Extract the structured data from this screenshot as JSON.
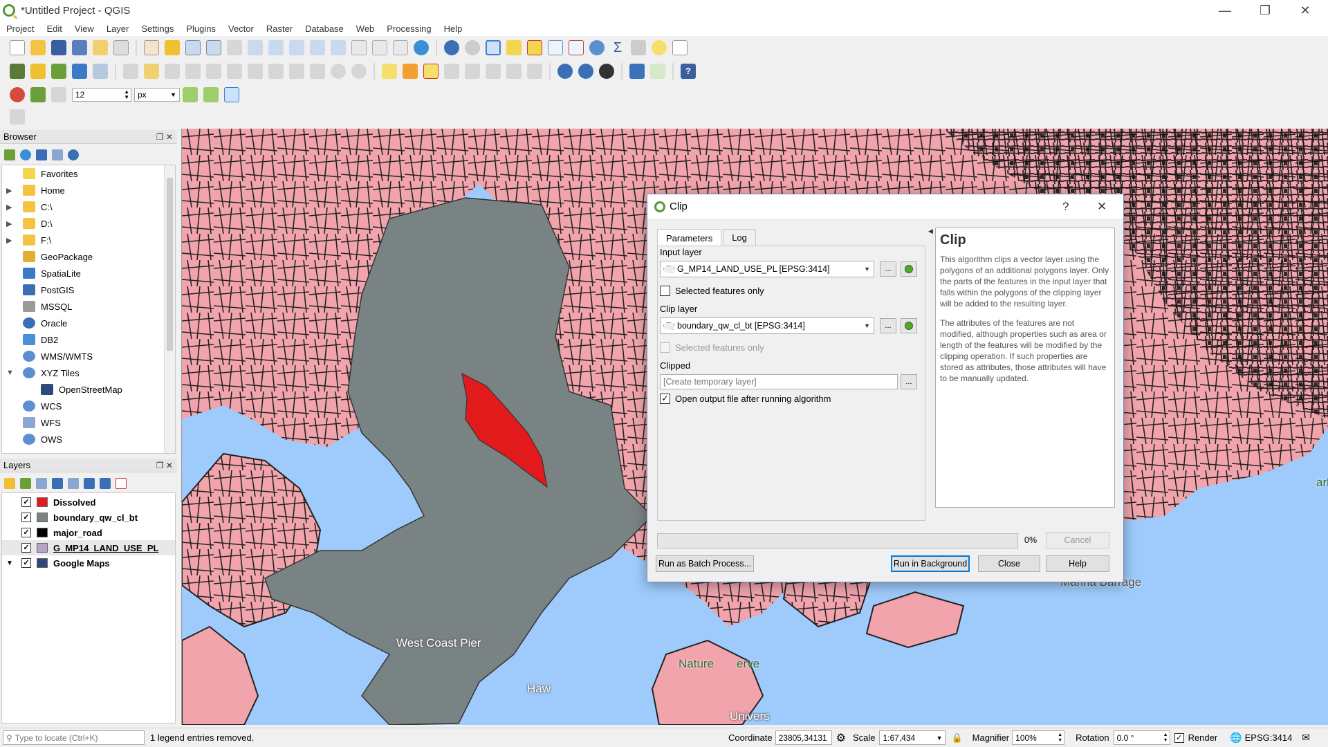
{
  "window": {
    "title": "*Untitled Project - QGIS"
  },
  "menu": [
    "Project",
    "Edit",
    "View",
    "Layer",
    "Settings",
    "Plugins",
    "Vector",
    "Raster",
    "Database",
    "Web",
    "Processing",
    "Help"
  ],
  "toolbar": {
    "snapping_tolerance": "12",
    "snapping_units": "px"
  },
  "browser": {
    "title": "Browser",
    "items": [
      {
        "label": "Favorites",
        "icon": "star-icon",
        "expandable": false
      },
      {
        "label": "Home",
        "icon": "folder-icon",
        "expandable": true
      },
      {
        "label": "C:\\",
        "icon": "folder-icon",
        "expandable": true
      },
      {
        "label": "D:\\",
        "icon": "folder-icon",
        "expandable": true
      },
      {
        "label": "F:\\",
        "icon": "folder-icon",
        "expandable": true
      },
      {
        "label": "GeoPackage",
        "icon": "geopackage-icon",
        "expandable": false
      },
      {
        "label": "SpatiaLite",
        "icon": "spatialite-icon",
        "expandable": false
      },
      {
        "label": "PostGIS",
        "icon": "postgis-icon",
        "expandable": false
      },
      {
        "label": "MSSQL",
        "icon": "mssql-icon",
        "expandable": false
      },
      {
        "label": "Oracle",
        "icon": "oracle-icon",
        "expandable": false
      },
      {
        "label": "DB2",
        "icon": "db2-icon",
        "expandable": false
      },
      {
        "label": "WMS/WMTS",
        "icon": "globe-icon",
        "expandable": false
      },
      {
        "label": "XYZ Tiles",
        "icon": "globe-icon",
        "expandable": true
      },
      {
        "label": "OpenStreetMap",
        "icon": "tiles-icon",
        "expandable": false
      },
      {
        "label": "WCS",
        "icon": "globe-icon",
        "expandable": false
      },
      {
        "label": "WFS",
        "icon": "wfs-icon",
        "expandable": false
      },
      {
        "label": "OWS",
        "icon": "globe-icon",
        "expandable": false
      }
    ]
  },
  "layers": {
    "title": "Layers",
    "items": [
      {
        "name": "Dissolved",
        "color": "#e31a1c",
        "checked": true
      },
      {
        "name": "boundary_qw_cl_bt",
        "color": "#7a8384",
        "checked": true
      },
      {
        "name": "major_road",
        "color": "#000000",
        "checked": true
      },
      {
        "name": "G_MP14_LAND_USE_PL",
        "color": "#b9a3c9",
        "checked": true
      },
      {
        "name": "Google Maps",
        "color": "#2d4a7a",
        "checked": true
      }
    ]
  },
  "map": {
    "labels": [
      "West Coast Pier",
      "Haw",
      "Nature",
      "erve",
      "Marina Barrage",
      "Univers",
      "ark"
    ],
    "colors": {
      "water": "#9ecbfb",
      "land": "#f2a4ad",
      "road": "#222222",
      "boundary": "#7a8384",
      "dissolved": "#e31a1c"
    }
  },
  "dialog": {
    "title": "Clip",
    "help_glyph": "?",
    "close_glyph": "✕",
    "tabs": [
      "Parameters",
      "Log"
    ],
    "input_layer_label": "Input layer",
    "input_layer_value": "G_MP14_LAND_USE_PL [EPSG:3414]",
    "input_selected_only": "Selected features only",
    "clip_layer_label": "Clip layer",
    "clip_layer_value": "boundary_qw_cl_bt [EPSG:3414]",
    "clip_selected_only": "Selected features only",
    "clipped_label": "Clipped",
    "clipped_placeholder": "[Create temporary layer]",
    "open_output": "Open output file after running algorithm",
    "browse_label": "...",
    "help_title": "Clip",
    "help_p1": "This algorithm clips a vector layer using the polygons of an additional polygons layer. Only the parts of the features in the input layer that falls within the polygons of the clipping layer will be added to the resulting layer.",
    "help_p2": "The attributes of the features are not modified, although properties such as area or length of the features will be modified by the clipping operation. If such properties are stored as attributes, those attributes will have to be manually updated.",
    "progress_percent": "0%",
    "progress_value": 0,
    "cancel": "Cancel",
    "batch": "Run as Batch Process...",
    "run_bg": "Run in Background",
    "close": "Close",
    "help": "Help"
  },
  "status": {
    "locate_placeholder": "Type to locate (Ctrl+K)",
    "message": "1 legend entries removed.",
    "coordinate_label": "Coordinate",
    "coordinate_value": "23805,34131",
    "scale_label": "Scale",
    "scale_value": "1:67,434",
    "magnifier_label": "Magnifier",
    "magnifier_value": "100%",
    "rotation_label": "Rotation",
    "rotation_value": "0.0 °",
    "render_label": "Render",
    "crs": "EPSG:3414"
  }
}
